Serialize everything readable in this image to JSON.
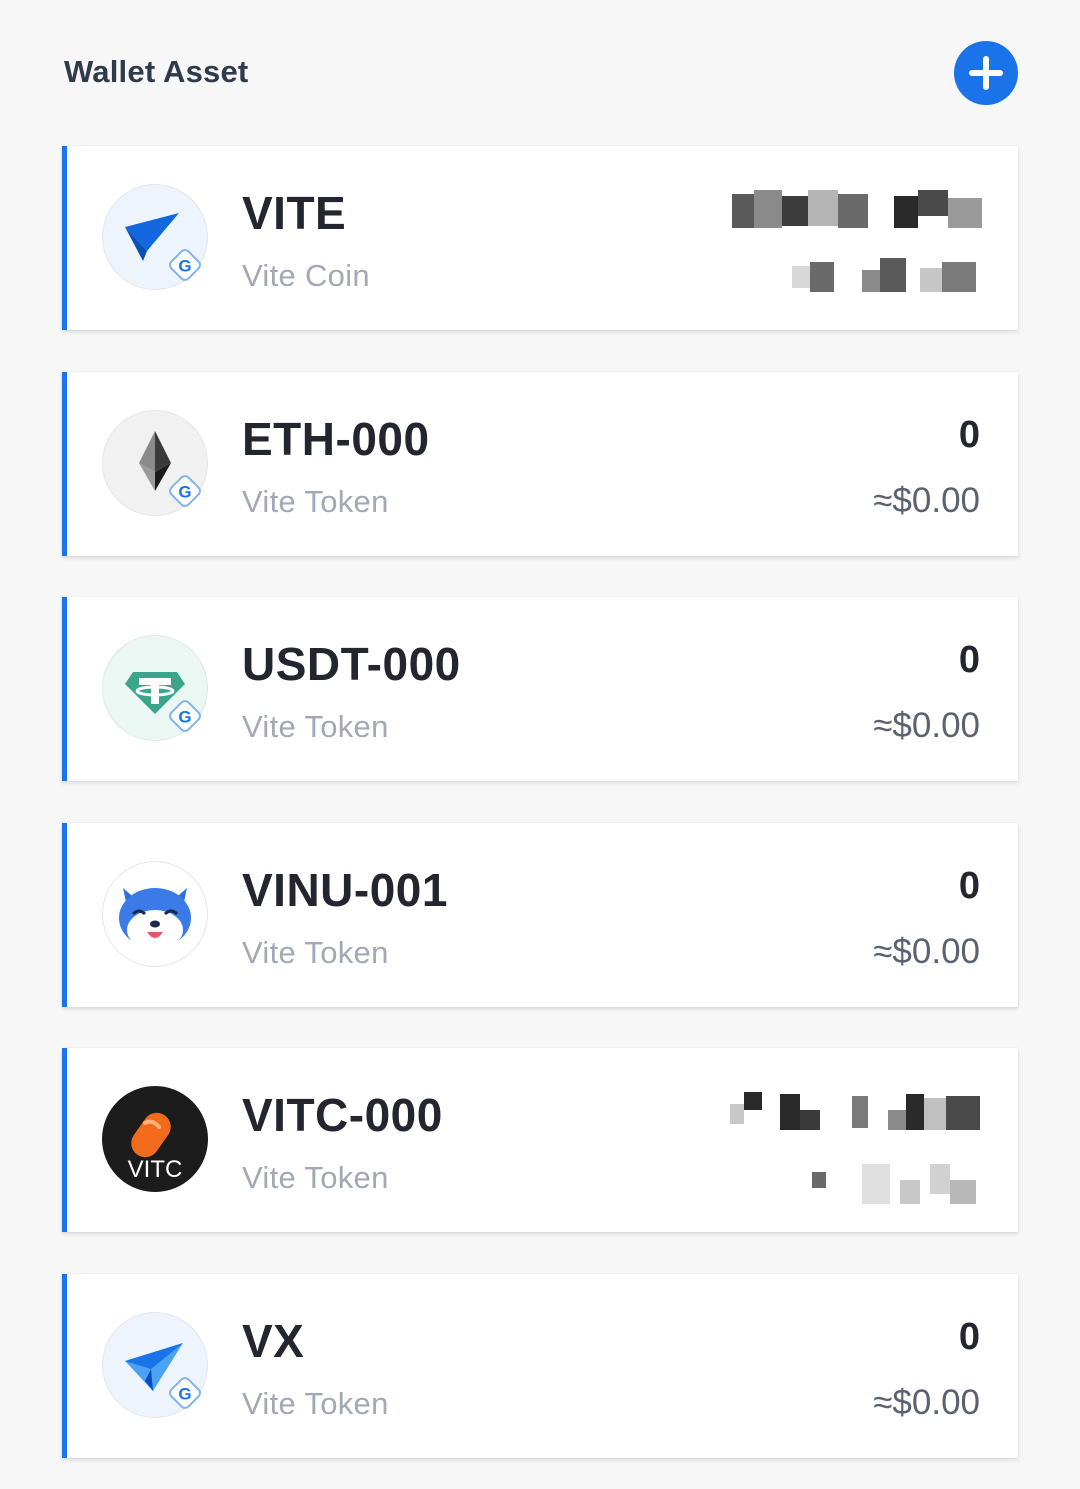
{
  "header": {
    "title": "Wallet Asset",
    "add_button_icon": "plus-icon",
    "accent_color": "#1a73e8"
  },
  "assets": [
    {
      "symbol": "VITE",
      "type": "Vite Coin",
      "balance": null,
      "fiat": null,
      "balance_obscured": true,
      "icon": "vite-logo-icon",
      "badge": "G"
    },
    {
      "symbol": "ETH-000",
      "type": "Vite Token",
      "balance": "0",
      "fiat": "≈$0.00",
      "balance_obscured": false,
      "icon": "eth-logo-icon",
      "badge": "G"
    },
    {
      "symbol": "USDT-000",
      "type": "Vite Token",
      "balance": "0",
      "fiat": "≈$0.00",
      "balance_obscured": false,
      "icon": "usdt-logo-icon",
      "badge": "G"
    },
    {
      "symbol": "VINU-001",
      "type": "Vite Token",
      "balance": "0",
      "fiat": "≈$0.00",
      "balance_obscured": false,
      "icon": "vinu-logo-icon",
      "badge": null
    },
    {
      "symbol": "VITC-000",
      "type": "Vite Token",
      "balance": null,
      "fiat": null,
      "balance_obscured": true,
      "icon": "vitc-logo-icon",
      "logo_text": "VITC",
      "badge": null
    },
    {
      "symbol": "VX",
      "type": "Vite Token",
      "balance": "0",
      "fiat": "≈$0.00",
      "balance_obscured": false,
      "icon": "vx-logo-icon",
      "badge": "G"
    }
  ]
}
